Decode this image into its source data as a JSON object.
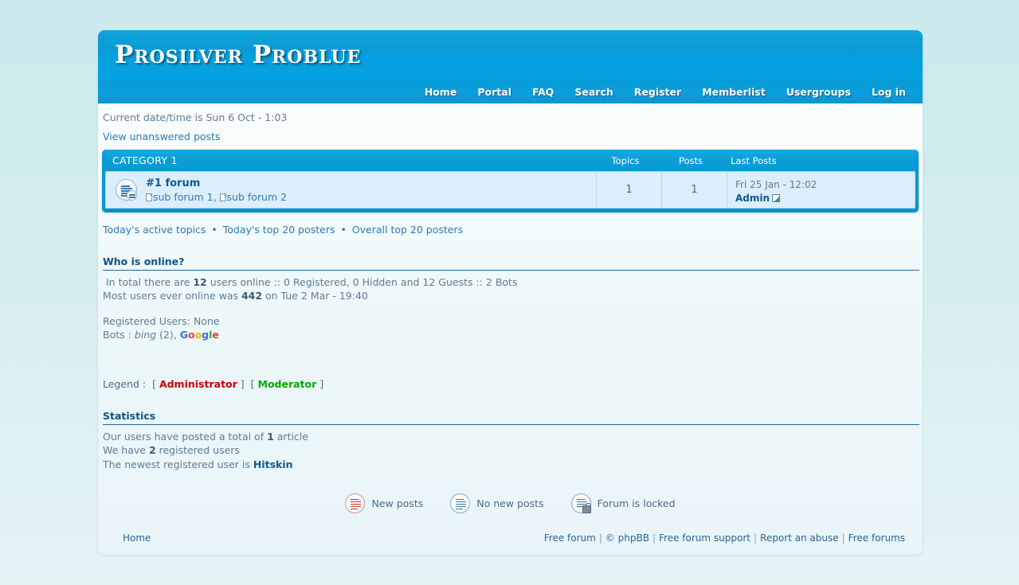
{
  "site": {
    "title": "Prosilver Problue"
  },
  "nav": {
    "items": [
      {
        "label": "Home",
        "name": "nav-home"
      },
      {
        "label": "Portal",
        "name": "nav-portal"
      },
      {
        "label": "FAQ",
        "name": "nav-faq"
      },
      {
        "label": "Search",
        "name": "nav-search"
      },
      {
        "label": "Register",
        "name": "nav-register"
      },
      {
        "label": "Memberlist",
        "name": "nav-memberlist"
      },
      {
        "label": "Usergroups",
        "name": "nav-usergroups"
      },
      {
        "label": "Log in",
        "name": "nav-login"
      }
    ]
  },
  "info": {
    "datetime": "Current date/time is Sun 6 Oct - 1:03",
    "unanswered_link": "View unanswered posts"
  },
  "category": {
    "title": "CATEGORY 1",
    "columns": {
      "topics": "Topics",
      "posts": "Posts",
      "last_posts": "Last Posts"
    },
    "forums": [
      {
        "name": "#1 forum",
        "subforums": [
          {
            "label": "sub forum 1"
          },
          {
            "label": "sub forum 2"
          }
        ],
        "subforum_separator": ", ",
        "topics": "1",
        "posts": "1",
        "last_post_date": "Fri 25 Jan - 12:02",
        "last_post_user": "Admin"
      }
    ]
  },
  "quicklinks": {
    "items": [
      {
        "label": "Today's active topics"
      },
      {
        "label": "Today's top 20 posters"
      },
      {
        "label": "Overall top 20 posters"
      }
    ],
    "separator": "•"
  },
  "who_is_online": {
    "heading": "Who is online?",
    "total_line_prefix": "In total there are ",
    "total_users": "12",
    "total_line_suffix": " users online :: 0 Registered, 0 Hidden and 12 Guests :: 2 Bots",
    "record_prefix": "Most users ever online was ",
    "record_value": "442",
    "record_suffix": " on Tue 2 Mar - 19:40",
    "registered_users": "Registered Users: None",
    "bots_prefix": "Bots : ",
    "bot_bing": "bing",
    "bot_bing_count": " (2), ",
    "bot_google_letters": [
      {
        "ch": "G",
        "color": "#3a6fd8"
      },
      {
        "ch": "o",
        "color": "#e0452c"
      },
      {
        "ch": "o",
        "color": "#f2b50a"
      },
      {
        "ch": "g",
        "color": "#3a6fd8"
      },
      {
        "ch": "l",
        "color": "#2faa4a"
      },
      {
        "ch": "e",
        "color": "#e0452c"
      }
    ]
  },
  "legend": {
    "label": "Legend :",
    "open_bracket": "[",
    "close_bracket": "]",
    "administrator": "Administrator",
    "moderator": "Moderator",
    "administrator_color": "#cc0000",
    "moderator_color": "#00aa00"
  },
  "statistics": {
    "heading": "Statistics",
    "posts_prefix": "Our users have posted a total of ",
    "posts_count": "1",
    "posts_suffix": " article",
    "users_prefix": "We have ",
    "users_count": "2",
    "users_suffix": " registered users",
    "newest_prefix": "The newest registered user is ",
    "newest_user": "Hitskin"
  },
  "icon_legend": {
    "items": [
      {
        "label": "New posts",
        "icon": "new-posts-icon"
      },
      {
        "label": "No new posts",
        "icon": "no-new-posts-icon"
      },
      {
        "label": "Forum is locked",
        "icon": "forum-locked-icon"
      }
    ]
  },
  "footer": {
    "home": "Home",
    "links": [
      {
        "label": "Free forum"
      },
      {
        "label": "© phpBB"
      },
      {
        "label": "Free forum support"
      },
      {
        "label": "Report an abuse"
      },
      {
        "label": "Free forums"
      }
    ],
    "separator": "|"
  },
  "colors": {
    "header_blue": "#0b9ad3",
    "accent_blue": "#0d5a94",
    "link_blue": "#2b7bb9",
    "row_bg": "#dceefb",
    "page_bg": "#d2ecef"
  }
}
